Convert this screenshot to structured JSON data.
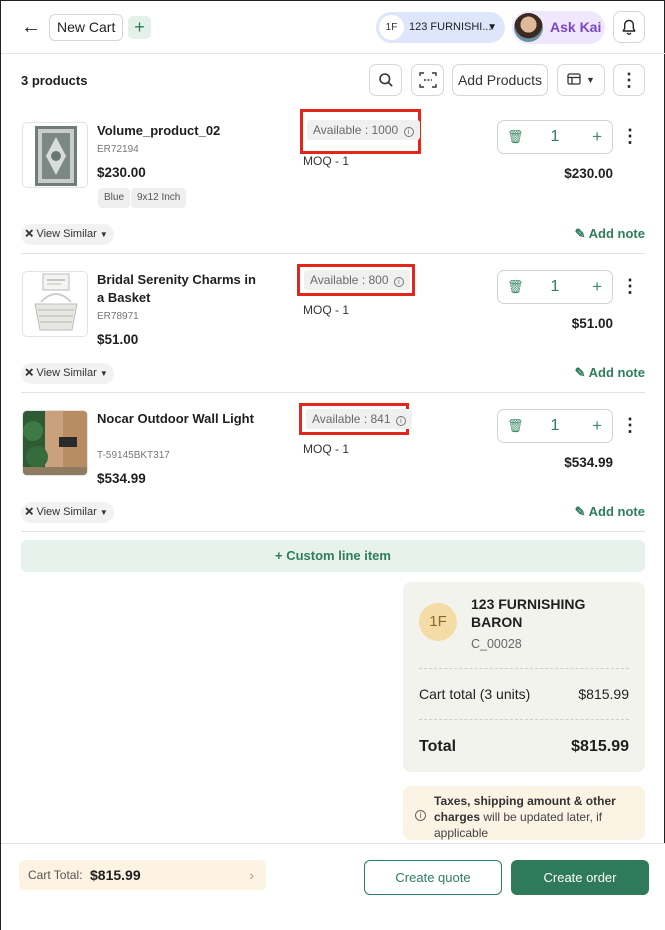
{
  "header": {
    "back_icon": "arrow-left-icon",
    "cart_name": "New Cart",
    "add_cart_symbol": "+",
    "customer_initials": "1F",
    "customer_name": "123 FURNISHI...",
    "assistant_label": "Ask Kai",
    "assistant_color": "#7a45c9"
  },
  "toolbar": {
    "product_count": "3 products",
    "add_products_label": "Add Products"
  },
  "products": [
    {
      "name": "Volume_product_02",
      "sku": "ER72194",
      "price": "$230.00",
      "tags": [
        "Blue",
        "9x12 Inch"
      ],
      "available": "Available : 1000",
      "moq": "MOQ - 1",
      "quantity": "1",
      "line_total": "$230.00",
      "view_similar": "View Similar",
      "add_note": "Add note"
    },
    {
      "name": "Bridal Serenity Charms in a Basket",
      "sku": "ER78971",
      "price": "$51.00",
      "tags": [],
      "available": "Available : 800",
      "moq": "MOQ - 1",
      "quantity": "1",
      "line_total": "$51.00",
      "view_similar": "View Similar",
      "add_note": "Add note"
    },
    {
      "name": "Nocar Outdoor Wall Light",
      "sku": "T-59145BKT317",
      "price": "$534.99",
      "tags": [],
      "available": "Available : 841",
      "moq": "MOQ - 1",
      "quantity": "1",
      "line_total": "$534.99",
      "view_similar": "View Similar",
      "add_note": "Add note"
    }
  ],
  "custom_line_item": "+ Custom line item",
  "summary": {
    "initials": "1F",
    "customer_name": "123 FURNISHING BARON",
    "customer_code": "C_00028",
    "cart_total_label": "Cart total (3 units)",
    "cart_total_value": "$815.99",
    "total_label": "Total",
    "total_value": "$815.99"
  },
  "taxes_note": {
    "bold": "Taxes, shipping amount & other charges",
    "rest": " will be updated later, if applicable"
  },
  "footer": {
    "cart_total_label": "Cart Total:",
    "cart_total_value": "$815.99",
    "create_quote": "Create quote",
    "create_order": "Create order"
  },
  "colors": {
    "accent_green": "#2e7d5b",
    "highlight_red": "#e3261c"
  }
}
